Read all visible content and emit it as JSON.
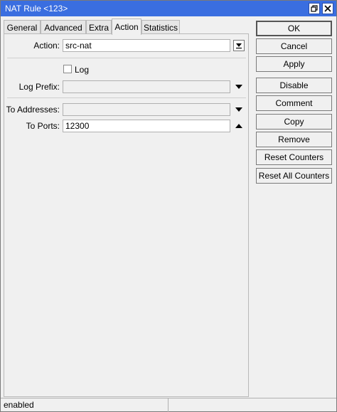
{
  "window": {
    "title": "NAT Rule <123>"
  },
  "tabs": [
    {
      "label": "General"
    },
    {
      "label": "Advanced"
    },
    {
      "label": "Extra"
    },
    {
      "label": "Action"
    },
    {
      "label": "Statistics"
    }
  ],
  "form": {
    "action_label": "Action:",
    "action_value": "src-nat",
    "log_label": "Log",
    "log_prefix_label": "Log Prefix:",
    "log_prefix_value": "",
    "to_addresses_label": "To Addresses:",
    "to_addresses_value": "",
    "to_ports_label": "To Ports:",
    "to_ports_value": "12300"
  },
  "buttons": {
    "ok": "OK",
    "cancel": "Cancel",
    "apply": "Apply",
    "disable": "Disable",
    "comment": "Comment",
    "copy": "Copy",
    "remove": "Remove",
    "reset_counters": "Reset Counters",
    "reset_all_counters": "Reset All Counters"
  },
  "status": {
    "state": "enabled",
    "right": ""
  }
}
